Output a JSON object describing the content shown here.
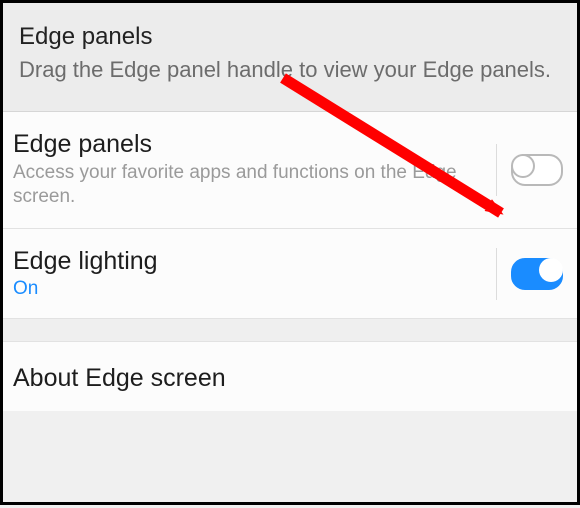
{
  "header": {
    "title": "Edge panels",
    "description": "Drag the Edge panel handle to view your Edge panels."
  },
  "settings": [
    {
      "title": "Edge panels",
      "description": "Access your favorite apps and functions on the Edge screen.",
      "status": "",
      "toggle_on": false
    },
    {
      "title": "Edge lighting",
      "description": "",
      "status": "On",
      "toggle_on": true
    }
  ],
  "about": {
    "title": "About Edge screen"
  },
  "colors": {
    "accent": "#1a8cff",
    "annotation": "#ff0000"
  },
  "annotation": {
    "target": "edge-panels-toggle",
    "kind": "arrow"
  }
}
